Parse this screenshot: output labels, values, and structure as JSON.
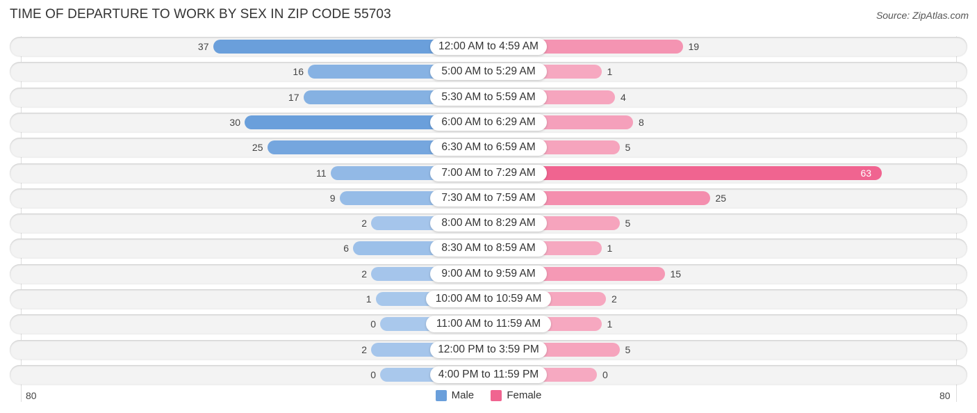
{
  "header": {
    "title": "TIME OF DEPARTURE TO WORK BY SEX IN ZIP CODE 55703",
    "source": "Source: ZipAtlas.com"
  },
  "colors": {
    "male": "#6a9fdb",
    "male_light": "#a9c8ec",
    "female": "#f06490",
    "female_light": "#f6a9c1"
  },
  "chart_data": {
    "type": "bar",
    "orientation": "horizontal-diverging",
    "title": "TIME OF DEPARTURE TO WORK BY SEX IN ZIP CODE 55703",
    "categories": [
      "12:00 AM to 4:59 AM",
      "5:00 AM to 5:29 AM",
      "5:30 AM to 5:59 AM",
      "6:00 AM to 6:29 AM",
      "6:30 AM to 6:59 AM",
      "7:00 AM to 7:29 AM",
      "7:30 AM to 7:59 AM",
      "8:00 AM to 8:29 AM",
      "8:30 AM to 8:59 AM",
      "9:00 AM to 9:59 AM",
      "10:00 AM to 10:59 AM",
      "11:00 AM to 11:59 AM",
      "12:00 PM to 3:59 PM",
      "4:00 PM to 11:59 PM"
    ],
    "series": [
      {
        "name": "Male",
        "values": [
          37,
          16,
          17,
          30,
          25,
          11,
          9,
          2,
          6,
          2,
          1,
          0,
          2,
          0
        ]
      },
      {
        "name": "Female",
        "values": [
          19,
          1,
          4,
          8,
          5,
          63,
          25,
          5,
          1,
          15,
          2,
          1,
          5,
          0
        ]
      }
    ],
    "axis": {
      "left_tick": "80",
      "right_tick": "80",
      "range": [
        80,
        80
      ]
    },
    "legend": {
      "position": "bottom-center",
      "entries": [
        "Male",
        "Female"
      ]
    }
  }
}
